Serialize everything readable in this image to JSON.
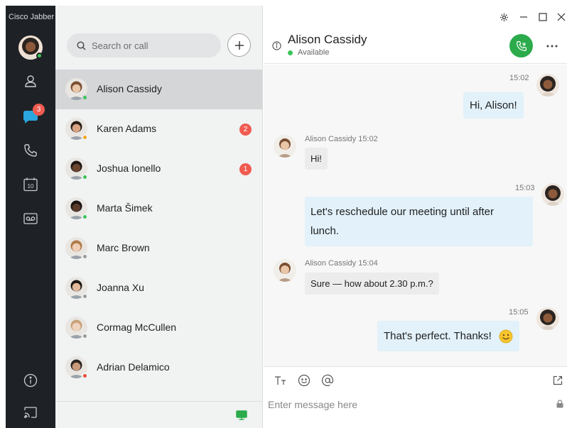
{
  "app": {
    "title": "Cisco Jabber"
  },
  "rail": {
    "chat_badge": "3",
    "calendar_day": "10"
  },
  "list": {
    "search_placeholder": "Search or call",
    "contacts": [
      {
        "name": "Alison Cassidy",
        "presence": "#3cc45a",
        "badge": ""
      },
      {
        "name": "Karen Adams",
        "presence": "#f5a623",
        "badge": "2"
      },
      {
        "name": "Joshua Ionello",
        "presence": "#3cc45a",
        "badge": "1"
      },
      {
        "name": "Marta Šimek",
        "presence": "#3cc45a",
        "badge": ""
      },
      {
        "name": "Marc Brown",
        "presence": "#9b9b9b",
        "badge": ""
      },
      {
        "name": "Joanna Xu",
        "presence": "#9b9b9b",
        "badge": ""
      },
      {
        "name": "Cormag McCullen",
        "presence": "#9b9b9b",
        "badge": ""
      },
      {
        "name": "Adrian Delamico",
        "presence": "#e94b3c",
        "badge": ""
      }
    ]
  },
  "chat": {
    "contact_name": "Alison Cassidy",
    "status": "Available",
    "messages": [
      {
        "time": "15:02",
        "text": "Hi, Alison!"
      },
      {
        "sender": "Alison Cassidy 15:02",
        "text": "Hi!"
      },
      {
        "time": "15:03",
        "line1": "Let's reschedule our meeting until after",
        "line2": "lunch."
      },
      {
        "sender": "Alison Cassidy 15:04",
        "text": "Sure — how about 2.30 p.m.?"
      },
      {
        "time": "15:05",
        "text": "That's perfect. Thanks!"
      }
    ],
    "composer_placeholder": "Enter message here"
  },
  "colors": {
    "rail_bg": "#1e2226",
    "accent_green": "#2bab4b",
    "badge_red": "#f15b50",
    "outgoing_bubble": "#e2f1fa"
  }
}
